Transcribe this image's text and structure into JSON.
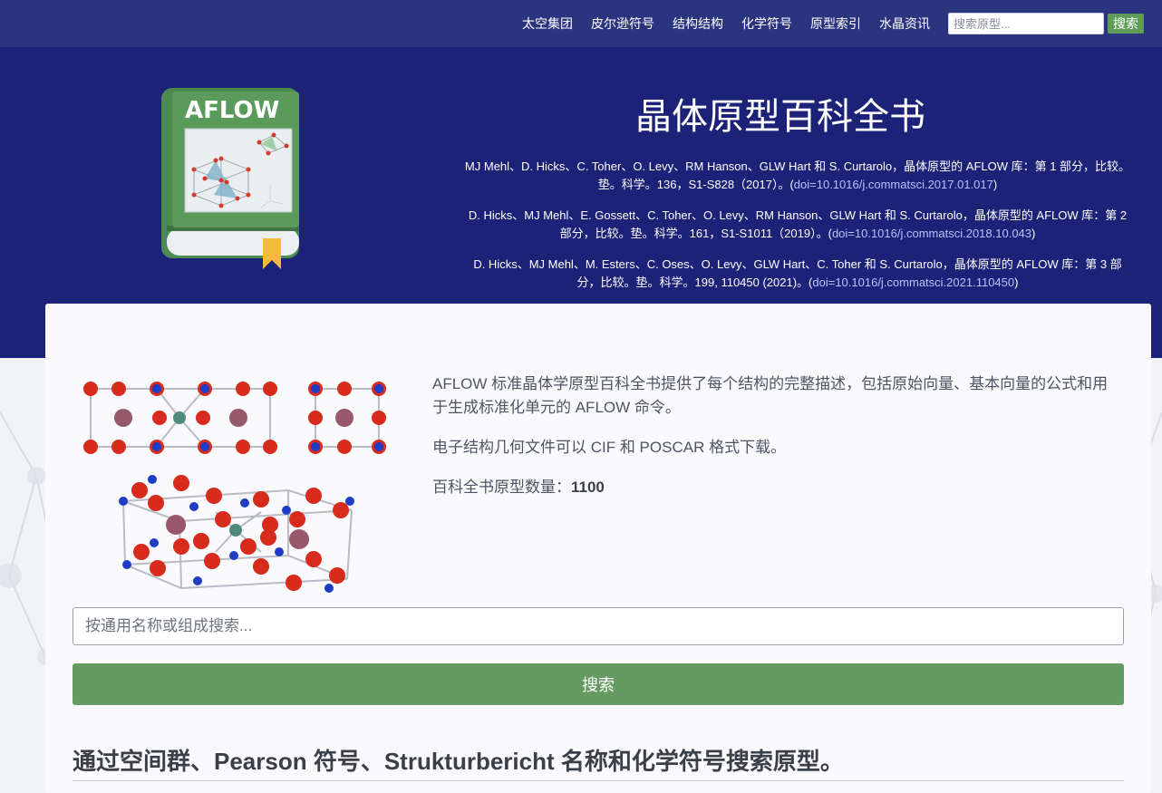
{
  "nav": {
    "links": [
      "太空集团",
      "皮尔逊符号",
      "结构结构",
      "化学符号",
      "原型索引",
      "水晶资讯"
    ],
    "search_placeholder": "搜索原型...",
    "search_button": "搜索"
  },
  "hero": {
    "logo_text": "AFLOW",
    "title": "晶体原型百科全书",
    "citations": [
      {
        "text": "MJ Mehl、D. Hicks、C. Toher、O. Levy、RM Hanson、GLW Hart 和 S. Curtarolo，晶体原型的 AFLOW 库：第 1 部分，比较。垫。科学。136，S1-S828（2017）。(",
        "doi": "doi=10.1016/j.commatsci.2017.01.017",
        "end": ")"
      },
      {
        "text": "D. Hicks、MJ Mehl、E. Gossett、C. Toher、O. Levy、RM Hanson、GLW Hart 和 S. Curtarolo，晶体原型的 AFLOW 库：第 2 部分，比较。垫。科学。161，S1-S1011（2019）。(",
        "doi": "doi=10.1016/j.commatsci.2018.10.043",
        "end": ")"
      },
      {
        "text": "D. Hicks、MJ Mehl、M. Esters、C. Oses、O. Levy、GLW Hart、C. Toher 和 S. Curtarolo，晶体原型的 AFLOW 库：第 3 部分，比较。垫。科学。199, 110450 (2021)。(",
        "doi": "doi=10.1016/j.commatsci.2021.110450",
        "end": ")"
      }
    ]
  },
  "main": {
    "intro_1": "AFLOW 标准晶体学原型百科全书提供了每个结构的完整描述，包括原始向量、基本向量的公式和用于生成标准化单元的 AFLOW 命令。",
    "intro_2": "电子结构几何文件可以 CIF 和 POSCAR 格式下载。",
    "count_label": "百科全书原型数量：",
    "count_value": "1100",
    "search_placeholder": "按通用名称或组成搜索...",
    "search_button": "搜索",
    "section_heading": "通过空间群、Pearson 符号、Strukturbericht 名称和化学符号搜索原型。"
  },
  "colors": {
    "nav_bg": "#2a347f",
    "hero_bg": "#1c2278",
    "button_green": "#659b62",
    "doi_link": "#b9c2ff"
  },
  "icons": [
    "aflow-book-logo-icon",
    "crystal-structure-illustration"
  ]
}
